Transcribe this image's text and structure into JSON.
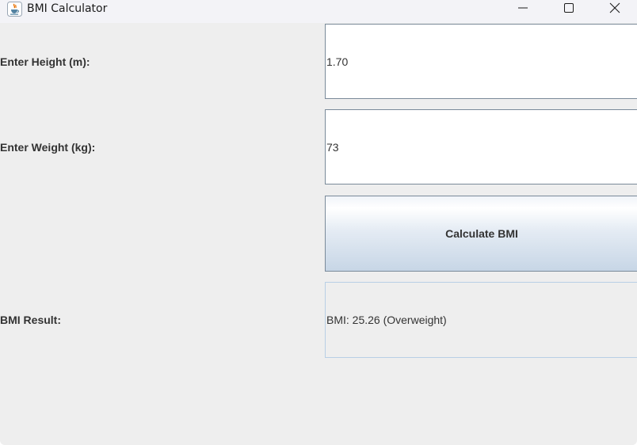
{
  "window": {
    "title": "BMI Calculator",
    "icon": "java-coffee-cup-icon",
    "controls": [
      "minimize-icon",
      "maximize-icon",
      "close-icon"
    ]
  },
  "form": {
    "height_label": "Enter Height (m):",
    "height_value": "1.70",
    "weight_label": "Enter Weight (kg):",
    "weight_value": "73",
    "calculate_label": "Calculate BMI",
    "result_label": "BMI Result:",
    "result_value": "BMI: 25.26 (Overweight)"
  },
  "colors": {
    "window_background": "#eeeeee",
    "titlebar_background": "#f3f3f7",
    "field_border": "#7a8a99",
    "result_border": "#b8cfe5",
    "text": "#333333"
  }
}
